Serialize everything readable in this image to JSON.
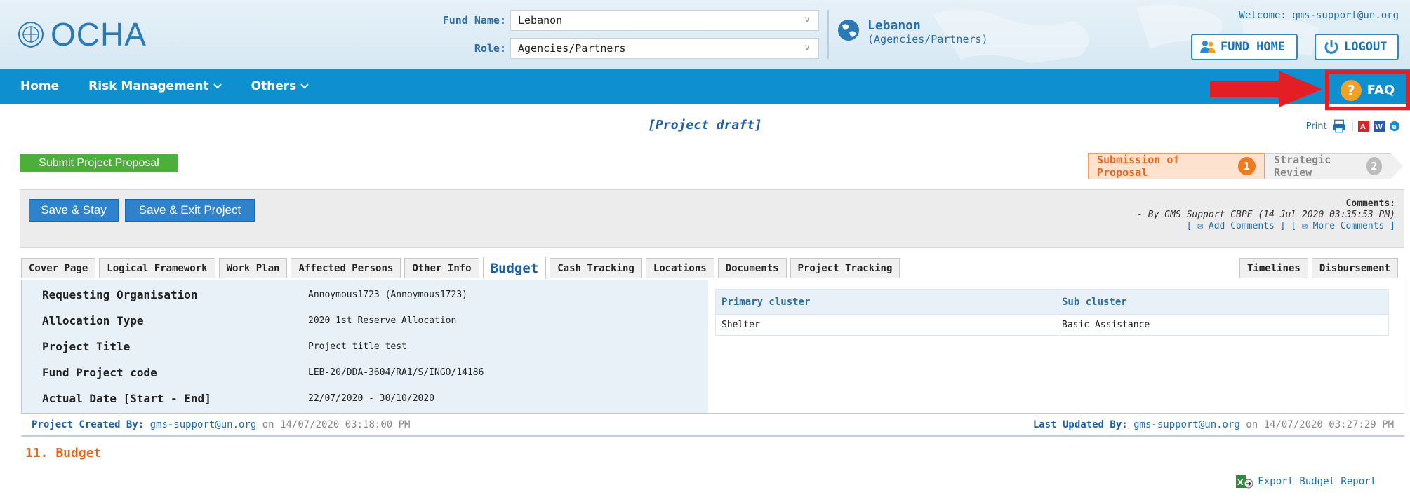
{
  "header": {
    "logo_text": "OCHA",
    "fund_label": "Fund Name:",
    "fund_value": "Lebanon",
    "role_label": "Role:",
    "role_value": "Agencies/Partners",
    "current_fund": "Lebanon",
    "current_role": "(Agencies/Partners)",
    "welcome": "Welcome: gms-support@un.org",
    "fund_home_label": "FUND HOME",
    "logout_label": "LOGOUT"
  },
  "nav": {
    "items": [
      {
        "label": "Home"
      },
      {
        "label": "Risk Management"
      },
      {
        "label": "Others"
      }
    ],
    "faq_label": "FAQ",
    "faq_symbol": "?"
  },
  "page": {
    "status_title": "[Project draft]",
    "print_label": "Print",
    "submit_label": "Submit Project Proposal"
  },
  "workflow": {
    "steps": [
      {
        "label": "Submission of Proposal",
        "num": "1"
      },
      {
        "label": "Strategic Review",
        "num": "2"
      }
    ]
  },
  "toolbar": {
    "save_stay": "Save & Stay",
    "save_exit": "Save & Exit Project",
    "comments_title": "Comments:",
    "comment_entry": "- By GMS Support CBPF (14 Jul 2020 03:35:53 PM)",
    "add_comments": "Add Comments",
    "more_comments": "More Comments"
  },
  "tabs": {
    "left": [
      "Cover Page",
      "Logical Framework",
      "Work Plan",
      "Affected Persons",
      "Other Info",
      "Budget",
      "Cash Tracking",
      "Locations",
      "Documents",
      "Project Tracking"
    ],
    "right": [
      "Timelines",
      "Disbursement"
    ],
    "active": "Budget"
  },
  "info": {
    "rows": [
      {
        "key": "Requesting Organisation",
        "value": "Annoymous1723 (Annoymous1723)"
      },
      {
        "key": "Allocation Type",
        "value": "2020 1st Reserve Allocation"
      },
      {
        "key": "Project Title",
        "value": "Project title test"
      },
      {
        "key": "Fund Project code",
        "value": "LEB-20/DDA-3604/RA1/S/INGO/14186"
      },
      {
        "key": "Actual Date [Start - End]",
        "value": "22/07/2020 - 30/10/2020"
      }
    ],
    "cluster": {
      "headers": [
        "Primary cluster",
        "Sub cluster"
      ],
      "row": [
        "Shelter",
        "Basic Assistance"
      ]
    }
  },
  "footer_meta": {
    "created_label": "Project Created By:",
    "created_user": "gms-support@un.org",
    "created_on": "on 14/07/2020 03:18:00 PM",
    "updated_label": "Last Updated By:",
    "updated_user": "gms-support@un.org",
    "updated_on": "on 14/07/2020 03:27:29 PM"
  },
  "budget": {
    "title": "11. Budget",
    "export_label": "Export Budget Report"
  },
  "colors": {
    "nav_bg": "#0e8fd0",
    "accent_orange": "#e8661c",
    "submit_green": "#4caf3a",
    "highlight_red": "#e31e24"
  }
}
